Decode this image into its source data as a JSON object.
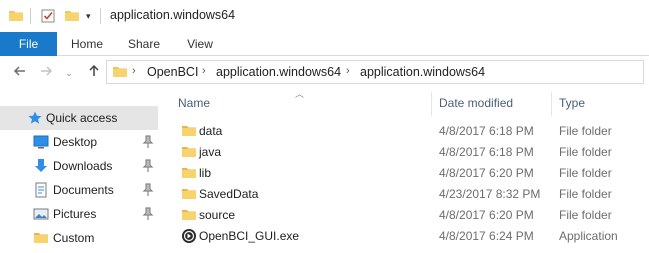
{
  "window": {
    "title": "application.windows64"
  },
  "ribbon": {
    "tabs": [
      {
        "label": "File"
      },
      {
        "label": "Home"
      },
      {
        "label": "Share"
      },
      {
        "label": "View"
      }
    ]
  },
  "navigation": {
    "back_icon": "arrow-left-icon",
    "forward_icon": "arrow-right-icon",
    "recent_icon": "chevron-down-icon",
    "up_icon": "arrow-up-icon"
  },
  "address": {
    "crumbs": [
      "OpenBCI",
      "application.windows64",
      "application.windows64"
    ]
  },
  "sidebar": {
    "items": [
      {
        "label": "Quick access",
        "icon": "star-icon"
      },
      {
        "label": "Desktop",
        "icon": "desktop-icon",
        "pinned": true
      },
      {
        "label": "Downloads",
        "icon": "download-icon",
        "pinned": true
      },
      {
        "label": "Documents",
        "icon": "documents-icon",
        "pinned": true
      },
      {
        "label": "Pictures",
        "icon": "pictures-icon",
        "pinned": true
      },
      {
        "label": "Custom",
        "icon": "folder-icon",
        "pinned": false
      }
    ]
  },
  "filelist": {
    "columns": {
      "name": "Name",
      "date": "Date modified",
      "type": "Type"
    },
    "rows": [
      {
        "name": "data",
        "date": "4/8/2017 6:18 PM",
        "type": "File folder",
        "icon": "folder-icon"
      },
      {
        "name": "java",
        "date": "4/8/2017 6:18 PM",
        "type": "File folder",
        "icon": "folder-icon"
      },
      {
        "name": "lib",
        "date": "4/8/2017 6:20 PM",
        "type": "File folder",
        "icon": "folder-icon"
      },
      {
        "name": "SavedData",
        "date": "4/23/2017 8:32 PM",
        "type": "File folder",
        "icon": "folder-icon"
      },
      {
        "name": "source",
        "date": "4/8/2017 6:20 PM",
        "type": "File folder",
        "icon": "folder-icon"
      },
      {
        "name": "OpenBCI_GUI.exe",
        "date": "4/8/2017 6:24 PM",
        "type": "Application",
        "icon": "application-icon"
      }
    ]
  },
  "colors": {
    "accent": "#1979ca",
    "folder": "#f1c65a",
    "selected": "#cce8ff"
  }
}
